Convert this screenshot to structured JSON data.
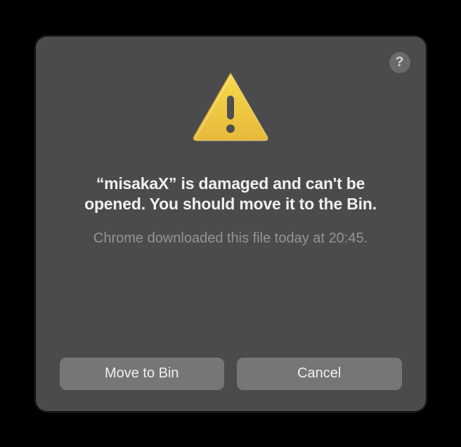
{
  "dialog": {
    "title": "“misakaX” is damaged and can't be opened. You should move it to the Bin.",
    "subtitle": "Chrome downloaded this file today at 20:45.",
    "buttons": {
      "primary": "Move to Bin",
      "secondary": "Cancel"
    },
    "help_label": "?"
  },
  "colors": {
    "dialog_bg": "#4b4b4d",
    "button_bg": "#767678",
    "text_primary": "#f0f0f1",
    "text_secondary": "#949496"
  }
}
